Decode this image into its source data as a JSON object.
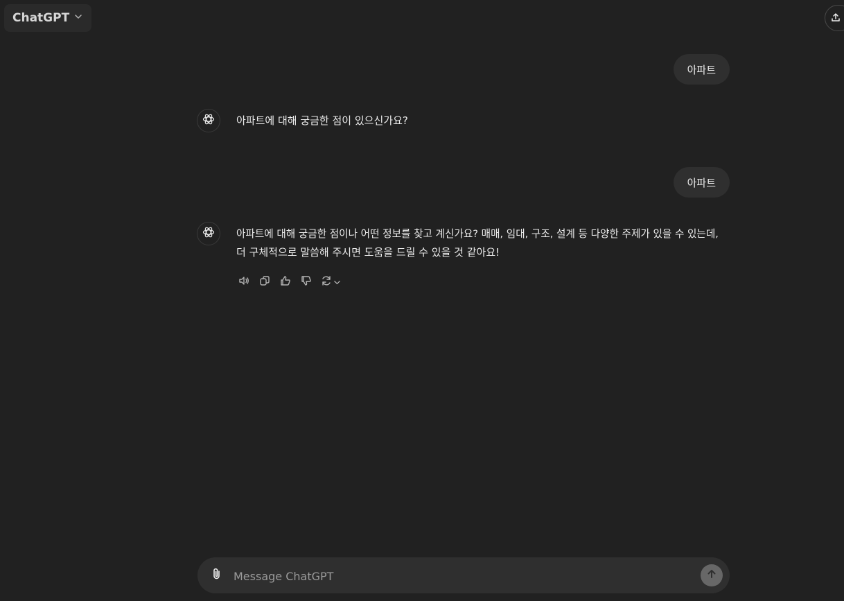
{
  "header": {
    "model_label": "ChatGPT",
    "model_chevron_icon": "chevron-down-icon",
    "share_icon": "share-upload-icon"
  },
  "conversation": [
    {
      "role": "user",
      "text": "아파트"
    },
    {
      "role": "assistant",
      "text": "아파트에 대해 궁금한 점이 있으신가요?"
    },
    {
      "role": "user",
      "text": "아파트"
    },
    {
      "role": "assistant",
      "lines": [
        "아파트에 대해 궁금한 점이나 어떤 정보를 찾고 계신가요? 매매, 임대, 구조, 설계 등 다양한 주제가 있을 수 있는데,",
        "더 구체적으로 말씀해 주시면 도움을 드릴 수 있을 것 같아요!"
      ]
    }
  ],
  "message_actions": {
    "icons": [
      "speaker-icon",
      "copy-icon",
      "thumbs-up-icon",
      "thumbs-down-icon",
      "regenerate-icon",
      "chevron-down-icon"
    ]
  },
  "composer": {
    "placeholder": "Message ChatGPT",
    "attach_icon": "paperclip-icon",
    "send_icon": "arrow-up-icon"
  },
  "colors": {
    "background": "#212121",
    "bubble": "#2f2f2f",
    "text": "#ececec",
    "send_button": "#676767"
  }
}
